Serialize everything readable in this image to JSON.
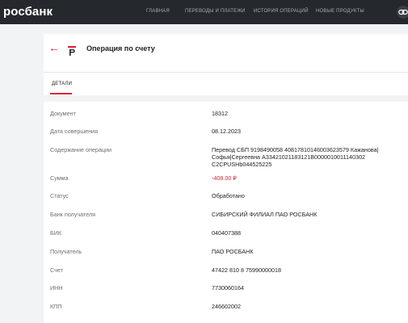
{
  "topbar": {
    "logo": "росбанк",
    "nav": [
      "ГЛАВНАЯ",
      "ПЕРЕВОДЫ И ПЛАТЕЖИ",
      "ИСТОРИЯ ОПЕРАЦИЙ",
      "НОВЫЕ ПРОДУКТЫ"
    ],
    "right_icon": "link-icon"
  },
  "header": {
    "back_icon": "back-arrow-icon",
    "bank_icon": "rosbank-r-icon",
    "title": "Операция по счету",
    "tab": "ДЕТАЛИ"
  },
  "details": [
    {
      "label": "Документ",
      "value": "18312"
    },
    {
      "label": "Дата совершения",
      "value": "08.12.2023"
    },
    {
      "label": "Содержание операции",
      "value_lines": [
        "Перевод СБП 9198490058 40817810146003623579 Кажанова|",
        "Софья|Сергеевна A33421021183121B0000010011140302",
        "C2CPUSHb044525225"
      ]
    },
    {
      "label": "Сумма",
      "value": "-408.00 ₽"
    },
    {
      "label": "Статус",
      "value": "Обработано"
    },
    {
      "label": "Банк получателя",
      "value": "СИБИРСКИЙ ФИЛИАЛ ПАО РОСБАНК"
    },
    {
      "label": "БИК",
      "value": "040407388"
    },
    {
      "label": "Получатель",
      "value": "ПАО РОСБАНК"
    },
    {
      "label": "Счет",
      "value": "47422 810 8 75990000018"
    },
    {
      "label": "ИНН",
      "value": "7730060164"
    },
    {
      "label": "КПП",
      "value": "246602002"
    }
  ],
  "colors": {
    "accent": "#d6263b",
    "topbar": "#25282d",
    "background": "#f2f3f5"
  }
}
